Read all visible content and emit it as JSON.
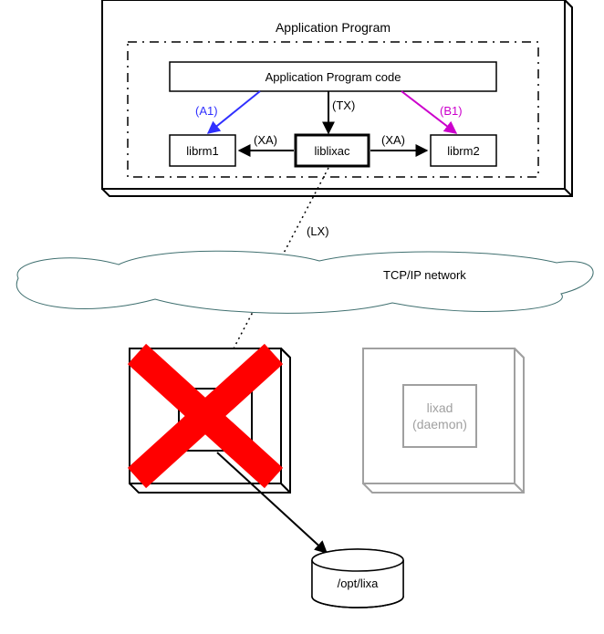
{
  "title": "Application Program",
  "app_code": "Application Program code",
  "a1_label": "(A1)",
  "b1_label": "(B1)",
  "tx_label": "(TX)",
  "xa_left_label": "(XA)",
  "xa_right_label": "(XA)",
  "lx_label": "(LX)",
  "librm1": "librm1",
  "librm2": "librm2",
  "liblixac": "liblixac",
  "network": "TCP/IP network",
  "lixad_line1": "lixad",
  "lixad_line2": "(daemon)",
  "disk": "/opt/lixa",
  "colors": {
    "a1": "#3030ff",
    "b1": "#cc00cc",
    "grey": "#a0a0a0",
    "cloud": "#407070",
    "x": "#ff0000"
  }
}
